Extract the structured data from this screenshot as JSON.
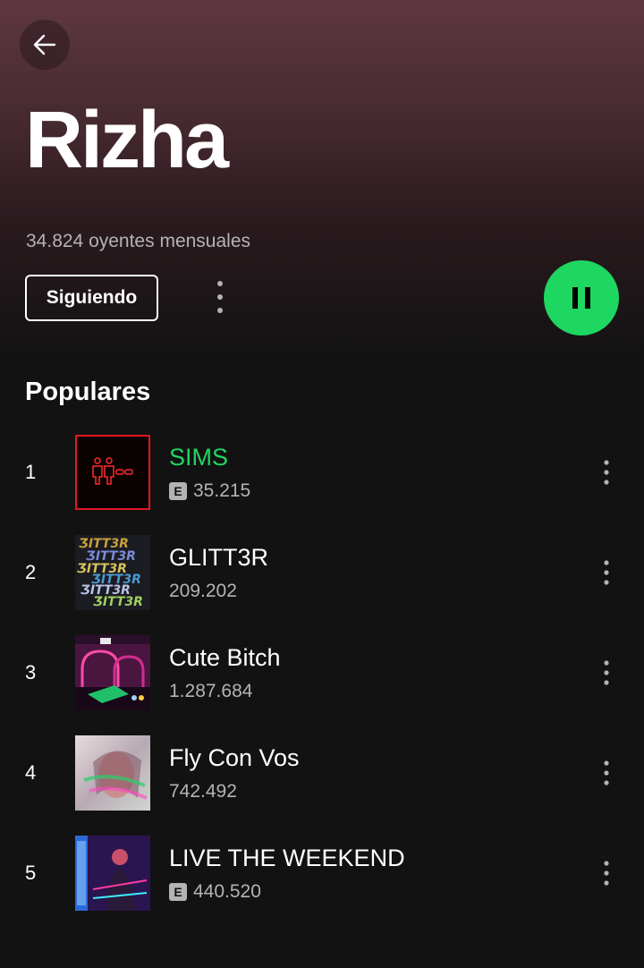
{
  "header": {
    "back_icon": "arrow-left-icon",
    "artist_name": "Rizha",
    "monthly_listeners": "34.824 oyentes mensuales",
    "follow_label": "Siguiendo",
    "more_icon": "more-vertical-icon",
    "play_icon": "pause-icon",
    "accent_color": "#1ed760"
  },
  "popular": {
    "title": "Populares",
    "tracks": [
      {
        "number": "1",
        "title": "SIMS",
        "explicit": true,
        "explicit_label": "E",
        "plays": "35.215",
        "playing": true
      },
      {
        "number": "2",
        "title": "GLITT3R",
        "explicit": false,
        "plays": "209.202",
        "playing": false
      },
      {
        "number": "3",
        "title": "Cute Bitch",
        "explicit": false,
        "plays": "1.287.684",
        "playing": false
      },
      {
        "number": "4",
        "title": "Fly Con Vos",
        "explicit": false,
        "plays": "742.492",
        "playing": false
      },
      {
        "number": "5",
        "title": "LIVE THE WEEKEND",
        "explicit": true,
        "explicit_label": "E",
        "plays": "440.520",
        "playing": false
      }
    ]
  }
}
